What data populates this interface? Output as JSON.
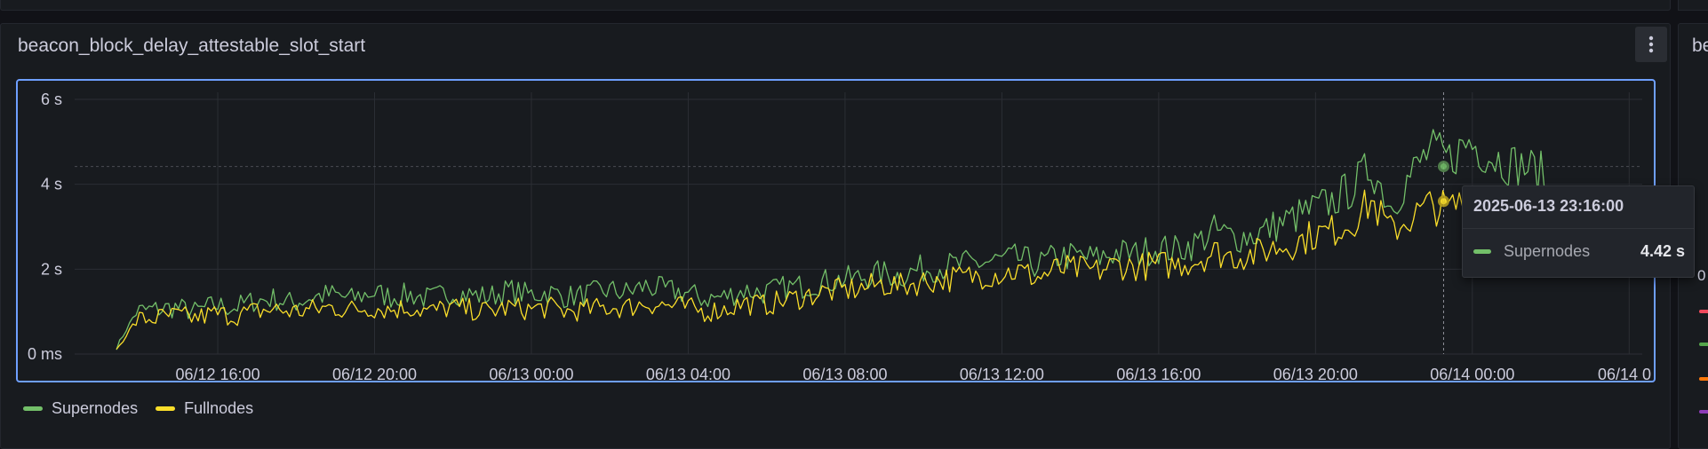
{
  "panel": {
    "title": "beacon_block_delay_attestable_slot_start",
    "menu_icon": "kebab-vertical-icon",
    "next_panel_title_fragment": "be",
    "next_panel_axis_fragment": "0",
    "next_panel_swatch_colors": [
      "#f2495c",
      "#56a64b",
      "#ff780a",
      "#8f3bb8"
    ]
  },
  "tooltip": {
    "time": "2025-06-13 23:16:00",
    "series": "Supernodes",
    "value": "4.42 s",
    "color": "#73bf69"
  },
  "legend": [
    {
      "name": "Supernodes",
      "color": "#73bf69"
    },
    {
      "name": "Fullnodes",
      "color": "#fade2a"
    }
  ],
  "chart_data": {
    "type": "line",
    "x_range": [
      "2025-06-12 12:21",
      "2025-06-14 04:20"
    ],
    "x_tick_labels": [
      "06/12 16:00",
      "06/12 20:00",
      "06/13 00:00",
      "06/13 04:00",
      "06/13 08:00",
      "06/13 12:00",
      "06/13 16:00",
      "06/13 20:00",
      "06/14 00:00",
      "06/14 0"
    ],
    "y_tick_labels": [
      "0 ms",
      "2 s",
      "4 s",
      "6 s"
    ],
    "ylim": [
      0,
      6
    ],
    "unit": "s",
    "grid": true,
    "legend_position": "bottom-left",
    "hover_x": "2025-06-13 23:16",
    "threshold_line_y": 4.42,
    "series": [
      {
        "name": "Supernodes",
        "color": "#73bf69",
        "x_start": "2025-06-12 13:25",
        "interval_minutes": 30,
        "values": [
          0.15,
          1.0,
          1.05,
          1.1,
          1.0,
          1.15,
          1.1,
          1.25,
          1.3,
          1.2,
          1.35,
          1.4,
          1.3,
          1.45,
          1.35,
          1.4,
          1.3,
          1.45,
          1.4,
          1.35,
          1.5,
          1.4,
          1.45,
          1.35,
          1.4,
          1.5,
          1.45,
          1.6,
          1.5,
          1.45,
          1.3,
          1.35,
          1.5,
          1.45,
          1.55,
          1.6,
          1.7,
          1.75,
          1.8,
          1.9,
          1.85,
          2.0,
          2.05,
          2.1,
          2.15,
          2.2,
          2.25,
          2.1,
          2.3,
          2.3,
          2.25,
          2.4,
          2.35,
          2.5,
          2.45,
          2.6,
          2.9,
          2.75,
          2.8,
          3.0,
          3.2,
          3.4,
          3.6,
          3.9,
          4.42,
          3.5,
          4.2,
          4.8,
          4.6,
          5.0,
          4.7,
          4.5,
          4.4,
          4.2
        ]
      },
      {
        "name": "Fullnodes",
        "color": "#fade2a",
        "x_start": "2025-06-12 13:25",
        "interval_minutes": 30,
        "values": [
          0.1,
          0.8,
          0.85,
          0.9,
          0.85,
          0.95,
          0.9,
          1.0,
          1.05,
          1.0,
          1.05,
          1.1,
          1.05,
          1.1,
          1.05,
          1.1,
          1.0,
          1.1,
          1.05,
          1.0,
          1.1,
          1.05,
          1.1,
          1.0,
          1.05,
          1.1,
          1.1,
          1.2,
          1.15,
          1.1,
          1.0,
          1.05,
          1.2,
          1.15,
          1.25,
          1.35,
          1.45,
          1.5,
          1.55,
          1.65,
          1.6,
          1.7,
          1.75,
          1.8,
          1.85,
          1.9,
          1.95,
          1.8,
          2.0,
          2.0,
          1.95,
          2.1,
          2.05,
          2.1,
          2.1,
          2.2,
          2.4,
          2.3,
          2.35,
          2.5,
          2.6,
          2.8,
          2.9,
          3.1,
          3.6,
          2.9,
          3.2,
          3.5,
          3.4,
          3.7,
          3.5,
          3.3,
          3.2,
          3.0
        ]
      }
    ]
  }
}
